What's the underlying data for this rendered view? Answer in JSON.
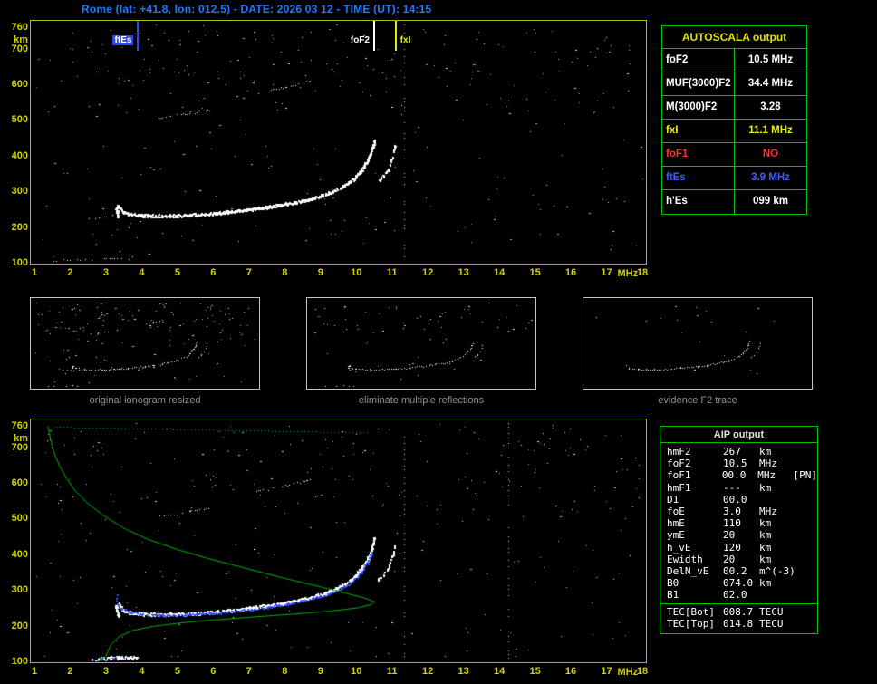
{
  "title": "Rome (lat: +41.8, lon: 012.5) - DATE: 2026 03 12 - TIME (UT): 14:15",
  "autoscala_table": {
    "title": "AUTOSCALA output",
    "rows": [
      {
        "param": "foF2",
        "value": "10.5 MHz",
        "color": "#ffffff"
      },
      {
        "param": "MUF(3000)F2",
        "value": "34.4 MHz",
        "color": "#ffffff"
      },
      {
        "param": "M(3000)F2",
        "value": "3.28",
        "color": "#ffffff"
      },
      {
        "param": "fxI",
        "value": "11.1 MHz",
        "color": "#f0f000"
      },
      {
        "param": "foF1",
        "value": "NO",
        "color": "#ff3232"
      },
      {
        "param": "ftEs",
        "value": "3.9 MHz",
        "color": "#3c5cff"
      },
      {
        "param": "h'Es",
        "value": "099   km",
        "color": "#ffffff"
      }
    ]
  },
  "aip_table": {
    "title": "AIP output",
    "rows": [
      {
        "name": "hmF2",
        "value": "267",
        "unit": "km",
        "extra": ""
      },
      {
        "name": "foF2",
        "value": "10.5",
        "unit": "MHz",
        "extra": ""
      },
      {
        "name": "foF1",
        "value": "00.0",
        "unit": "MHz",
        "extra": "[PN]"
      },
      {
        "name": "hmF1",
        "value": "---",
        "unit": "km",
        "extra": ""
      },
      {
        "name": "D1",
        "value": "00.0",
        "unit": "",
        "extra": ""
      },
      {
        "name": "foE",
        "value": "3.0",
        "unit": "MHz",
        "extra": ""
      },
      {
        "name": "hmE",
        "value": "110",
        "unit": "km",
        "extra": ""
      },
      {
        "name": "ymE",
        "value": "20",
        "unit": "km",
        "extra": ""
      },
      {
        "name": "h_vE",
        "value": "120",
        "unit": "km",
        "extra": ""
      },
      {
        "name": "Ewidth",
        "value": "20",
        "unit": "km",
        "extra": ""
      },
      {
        "name": "DelN_vE",
        "value": "00.2",
        "unit": "m^(-3)",
        "extra": ""
      },
      {
        "name": "B0",
        "value": "074.0",
        "unit": "km",
        "extra": ""
      },
      {
        "name": "B1",
        "value": "02.0",
        "unit": "",
        "extra": ""
      },
      {
        "name": "TEC[Bot]",
        "value": "008.7",
        "unit": "TECU",
        "extra": "",
        "sep_before": true
      },
      {
        "name": "TEC[Top]",
        "value": "014.8",
        "unit": "TECU",
        "extra": ""
      }
    ]
  },
  "thumbnails": {
    "captions": [
      "original ionogram resized",
      "eliminate multiple reflections",
      "evidence F2 trace"
    ],
    "panels": [
      {
        "use": [
          "f2-trace",
          "x-trace",
          "start-hook",
          "second-hop-a",
          "second-hop-b",
          "es-trace",
          "lead-in"
        ],
        "noise": 150,
        "seed": 3
      },
      {
        "use": [
          "f2-trace",
          "x-trace",
          "start-hook",
          "es-trace"
        ],
        "noise": 70,
        "seed": 5
      },
      {
        "use": [
          "f2-trace",
          "x-trace"
        ],
        "noise": 18,
        "seed": 9
      }
    ]
  },
  "chart_data": [
    {
      "id": "top_ionogram",
      "type": "scatter",
      "title": "scaled ionogram with AUTOSCALA critical frequencies",
      "xlabel": "MHz",
      "ylabel": "km",
      "xlim": [
        1,
        18
      ],
      "ylim": [
        100,
        760
      ],
      "x_ticks": [
        1,
        2,
        3,
        4,
        5,
        6,
        7,
        8,
        9,
        10,
        11,
        12,
        13,
        14,
        15,
        16,
        17,
        18
      ],
      "y_ticks": [
        760,
        700,
        600,
        500,
        400,
        300,
        200,
        100
      ],
      "grid": false,
      "markers": [
        {
          "label": "ftEs",
          "freq": 3.9,
          "color": "#2a46ee",
          "style": "badge",
          "side": "left"
        },
        {
          "label": "foF2",
          "freq": 10.5,
          "color": "#ffffff",
          "style": "text",
          "side": "left"
        },
        {
          "label": "fxI",
          "freq": 11.1,
          "color": "#e8e800",
          "style": "text",
          "side": "right"
        }
      ],
      "noise": {
        "count": 330,
        "seed": 11
      },
      "noise_columns": [
        11.33
      ],
      "series": [
        {
          "name": "f2-trace",
          "color": "#ffffff",
          "size": 2,
          "jx": 1.5,
          "jy": 3,
          "density": 2,
          "step": 1.2,
          "skip": 0.05,
          "points": [
            [
              3.35,
              258
            ],
            [
              3.5,
              242
            ],
            [
              3.7,
              237
            ],
            [
              4.0,
              234
            ],
            [
              4.5,
              232
            ],
            [
              5.0,
              233
            ],
            [
              5.5,
              235
            ],
            [
              6.0,
              239
            ],
            [
              6.5,
              244
            ],
            [
              7.0,
              250
            ],
            [
              7.5,
              257
            ],
            [
              8.0,
              265
            ],
            [
              8.5,
              275
            ],
            [
              9.0,
              288
            ],
            [
              9.3,
              299
            ],
            [
              9.6,
              314
            ],
            [
              9.9,
              334
            ],
            [
              10.1,
              356
            ],
            [
              10.3,
              385
            ],
            [
              10.42,
              415
            ],
            [
              10.5,
              445
            ]
          ]
        },
        {
          "name": "x-trace",
          "color": "#ffffff",
          "size": 2,
          "jx": 1.5,
          "jy": 2.5,
          "density": 1,
          "step": 1.5,
          "skip": 0.15,
          "points": [
            [
              10.6,
              328
            ],
            [
              10.75,
              344
            ],
            [
              10.9,
              366
            ],
            [
              11.0,
              396
            ],
            [
              11.08,
              432
            ]
          ]
        },
        {
          "name": "start-hook",
          "color": "#ffffff",
          "size": 2,
          "jx": 2,
          "jy": 2,
          "density": 2,
          "step": 1.2,
          "skip": 0.05,
          "points": [
            [
              3.33,
              228
            ],
            [
              3.3,
              244
            ],
            [
              3.28,
              256
            ],
            [
              3.33,
              264
            ]
          ]
        },
        {
          "name": "lead-in",
          "color": "#ffffff",
          "size": 1,
          "jx": 2,
          "jy": 2,
          "density": 1,
          "step": 2.5,
          "skip": 0.45,
          "points": [
            [
              2.5,
              222
            ],
            [
              2.75,
              227
            ],
            [
              3.0,
              231
            ],
            [
              3.2,
              233
            ]
          ]
        },
        {
          "name": "second-hop-a",
          "color": "#ffffff",
          "size": 1,
          "jx": 1.5,
          "jy": 2,
          "density": 1,
          "step": 2.2,
          "skip": 0.35,
          "points": [
            [
              4.35,
              505
            ],
            [
              4.75,
              511
            ],
            [
              5.15,
              517
            ],
            [
              5.55,
              523
            ],
            [
              5.9,
              529
            ]
          ]
        },
        {
          "name": "second-hop-b",
          "color": "#ffffff",
          "size": 1,
          "jx": 1.5,
          "jy": 2,
          "density": 1,
          "step": 2.2,
          "skip": 0.35,
          "points": [
            [
              7.15,
              575
            ],
            [
              7.55,
              583
            ],
            [
              7.95,
              592
            ],
            [
              8.35,
              601
            ],
            [
              8.7,
              611
            ]
          ]
        },
        {
          "name": "es-trace",
          "color": "#ffffff",
          "size": 1,
          "jx": 2,
          "jy": 2,
          "density": 1,
          "step": 3,
          "skip": 0.5,
          "points": [
            [
              1.55,
              106
            ],
            [
              1.9,
              108
            ],
            [
              2.25,
              110
            ],
            [
              2.6,
              109
            ],
            [
              2.95,
              111
            ],
            [
              3.3,
              112
            ],
            [
              3.6,
              110
            ]
          ]
        }
      ]
    },
    {
      "id": "bottom_ionogram",
      "type": "scatter",
      "title": "ionogram with restored trace (blue) and AIP electron density profile (green)",
      "xlabel": "MHz",
      "ylabel": "km",
      "xlim": [
        1,
        18
      ],
      "ylim": [
        100,
        760
      ],
      "x_ticks": [
        1,
        2,
        3,
        4,
        5,
        6,
        7,
        8,
        9,
        10,
        11,
        12,
        13,
        14,
        15,
        16,
        17,
        18
      ],
      "y_ticks": [
        760,
        700,
        600,
        500,
        400,
        300,
        200,
        100
      ],
      "grid": false,
      "markers": [],
      "noise": {
        "count": 330,
        "seed": 23
      },
      "noise_columns": [
        11.33,
        14.25
      ],
      "series": [
        {
          "ref": "f2-trace"
        },
        {
          "ref": "x-trace"
        },
        {
          "ref": "start-hook"
        },
        {
          "ref": "second-hop-a"
        },
        {
          "ref": "second-hop-b"
        },
        {
          "name": "es-blob",
          "color": "#ffffff",
          "size": 2,
          "jx": 2,
          "jy": 3,
          "density": 2,
          "step": 1.5,
          "skip": 0.1,
          "points": [
            [
              2.6,
              106
            ],
            [
              2.95,
              109
            ],
            [
              3.3,
              112
            ],
            [
              3.6,
              113
            ],
            [
              3.85,
              111
            ]
          ]
        },
        {
          "name": "restored-trace",
          "color": "#3350ff",
          "size": 2,
          "jx": 1.5,
          "jy": 2,
          "density": 1,
          "step": 1.4,
          "skip": 0.12,
          "points": [
            [
              3.28,
              286
            ],
            [
              3.3,
              262
            ],
            [
              3.45,
              247
            ],
            [
              3.7,
              239
            ],
            [
              4.0,
              233
            ],
            [
              4.5,
              230
            ],
            [
              5.0,
              231
            ],
            [
              5.5,
              233
            ],
            [
              6.0,
              236
            ],
            [
              6.5,
              241
            ],
            [
              7.0,
              247
            ],
            [
              7.5,
              253
            ],
            [
              8.0,
              261
            ],
            [
              8.5,
              271
            ],
            [
              9.0,
              283
            ],
            [
              9.4,
              298
            ],
            [
              9.8,
              319
            ],
            [
              10.1,
              347
            ],
            [
              10.3,
              377
            ],
            [
              10.42,
              406
            ]
          ]
        },
        {
          "name": "restored-es",
          "color": "#3350ff",
          "size": 2,
          "jx": 2,
          "jy": 2,
          "density": 1,
          "step": 3,
          "skip": 0.4,
          "points": [
            [
              2.5,
              105
            ],
            [
              2.85,
              108
            ],
            [
              3.2,
              112
            ],
            [
              3.5,
              115
            ]
          ]
        },
        {
          "name": "density-profile",
          "type": "line",
          "color": "#00b400",
          "width": 1,
          "points": [
            [
              1.38,
              758
            ],
            [
              1.45,
              722
            ],
            [
              1.55,
              684
            ],
            [
              1.7,
              648
            ],
            [
              1.9,
              612
            ],
            [
              2.15,
              577
            ],
            [
              2.5,
              542
            ],
            [
              2.95,
              507
            ],
            [
              3.5,
              473
            ],
            [
              4.2,
              441
            ],
            [
              5.0,
              413
            ],
            [
              5.9,
              387
            ],
            [
              6.9,
              361
            ],
            [
              7.9,
              335
            ],
            [
              8.9,
              311
            ],
            [
              9.7,
              291
            ],
            [
              10.25,
              277
            ],
            [
              10.5,
              267
            ],
            [
              10.42,
              259
            ],
            [
              10.05,
              250
            ],
            [
              9.3,
              241
            ],
            [
              8.2,
              232
            ],
            [
              6.8,
              222
            ],
            [
              5.4,
              211
            ],
            [
              4.3,
              198
            ],
            [
              3.7,
              185
            ],
            [
              3.35,
              168
            ],
            [
              3.15,
              148
            ],
            [
              3.05,
              128
            ],
            [
              3.0,
              114
            ],
            [
              2.9,
              105
            ],
            [
              2.72,
              99
            ]
          ]
        },
        {
          "name": "topside-dotted",
          "type": "dotline",
          "color": "#00b400",
          "points": [
            [
              1.6,
              757
            ],
            [
              10.3,
              741
            ]
          ]
        }
      ]
    }
  ]
}
